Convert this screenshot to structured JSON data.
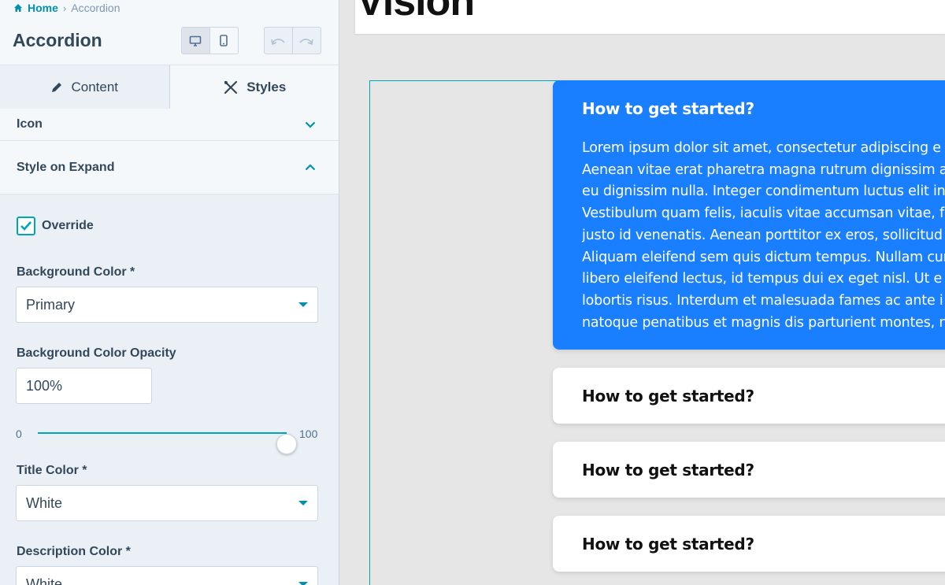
{
  "breadcrumb": {
    "home": "Home",
    "current": "Accordion"
  },
  "panel": {
    "title": "Accordion"
  },
  "tabs": {
    "content": "Content",
    "styles": "Styles"
  },
  "sections": {
    "icon": "Icon",
    "style_on_expand": "Style on Expand"
  },
  "override": {
    "label": "Override",
    "checked": true
  },
  "fields": {
    "background_color": {
      "label": "Background Color  *",
      "value": "Primary"
    },
    "background_opacity": {
      "label": "Background Color Opacity",
      "value": "100%"
    },
    "title_color": {
      "label": "Title Color  *",
      "value": "White"
    },
    "description_color": {
      "label": "Description Color  *",
      "value": "White"
    }
  },
  "slider": {
    "min": "0",
    "max": "100",
    "value": 100
  },
  "preview": {
    "heading": "Vision",
    "items": [
      {
        "title": "How to get started?",
        "expanded": true,
        "description_lines": [
          "Lorem ipsum dolor sit amet, consectetur adipiscing e",
          "Aenean vitae erat pharetra magna rutrum dignissim a",
          "eu dignissim nulla. Integer condimentum luctus elit in",
          "Vestibulum quam felis, iaculis vitae accumsan vitae, f",
          "justo id venenatis. Aenean porttitor ex eros, sollicitud",
          "Aliquam eleifend sem quis dictum tempus. Nullam cur",
          "libero eleifend lectus, id tempus dui ex eget nisl. Ut e",
          "lobortis risus. Interdum et malesuada fames ac ante i",
          "natoque penatibus et magnis dis parturient montes, n"
        ]
      },
      {
        "title": "How to get started?",
        "expanded": false
      },
      {
        "title": "How to get started?",
        "expanded": false
      },
      {
        "title": "How to get started?",
        "expanded": false
      }
    ]
  },
  "colors": {
    "accent": "#00a4bd",
    "primary": "#1a7fff",
    "link": "#0091ae"
  },
  "icons": {
    "home": "home-icon",
    "desktop": "desktop-icon",
    "mobile": "mobile-icon",
    "undo": "undo-icon",
    "redo": "redo-icon",
    "pencil": "pencil-icon",
    "styles": "brush-icon",
    "chevron_down": "chevron-down-icon",
    "chevron_up": "chevron-up-icon",
    "check": "check-icon"
  }
}
